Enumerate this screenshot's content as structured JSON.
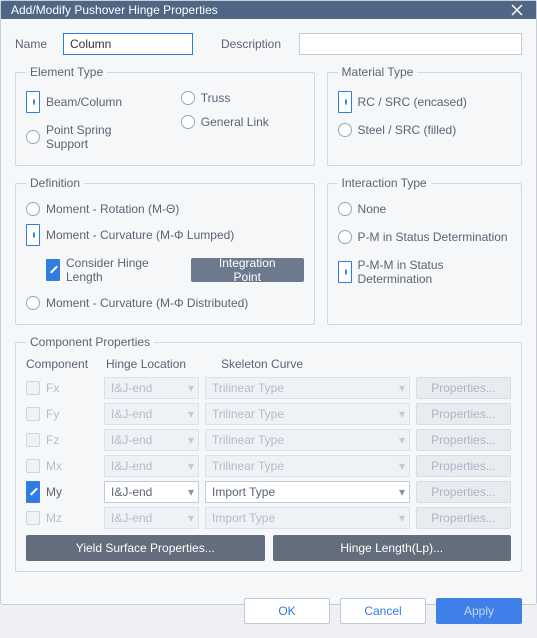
{
  "window_title": "Add/Modify Pushover Hinge Properties",
  "name_label": "Name",
  "name_value": "Column",
  "desc_label": "Description",
  "desc_value": "",
  "element_type": {
    "legend": "Element Type",
    "beam": "Beam/Column",
    "truss": "Truss",
    "point": "Point Spring Support",
    "general": "General Link"
  },
  "material_type": {
    "legend": "Material Type",
    "rc": "RC / SRC (encased)",
    "steel": "Steel / SRC (filled)"
  },
  "definition": {
    "legend": "Definition",
    "mr": "Moment - Rotation (M-Θ)",
    "mcl": "Moment - Curvature (M-Φ Lumped)",
    "chl": "Consider Hinge Length",
    "ip": "Integration Point",
    "mcd": "Moment - Curvature (M-Φ Distributed)"
  },
  "interaction": {
    "legend": "Interaction Type",
    "none": "None",
    "pm": "P-M in Status Determination",
    "pmm": "P-M-M in Status Determination"
  },
  "component_props": {
    "legend": "Component Properties",
    "hdr_comp": "Component",
    "hdr_hl": "Hinge Location",
    "hdr_sc": "Skeleton Curve",
    "hl_val": "I&J-end",
    "sc_tri": "Trilinear Type",
    "sc_imp": "Import Type",
    "prop": "Properties...",
    "rows": [
      "Fx",
      "Fy",
      "Fz",
      "Mx",
      "My",
      "Mz"
    ],
    "yield": "Yield Surface Properties...",
    "hlp": "Hinge Length(Lp)..."
  },
  "buttons": {
    "ok": "OK",
    "cancel": "Cancel",
    "apply": "Apply"
  }
}
